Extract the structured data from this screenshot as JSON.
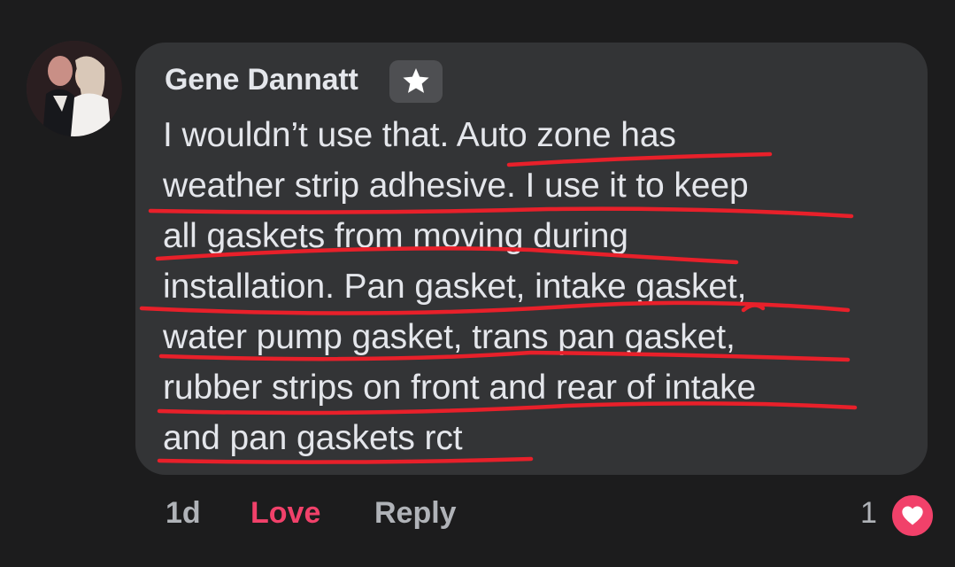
{
  "comment": {
    "author": "Gene Dannatt",
    "badge_icon": "star-icon",
    "lines": [
      "I wouldn’t use that. Auto zone has",
      "weather strip adhesive. I use it to keep",
      "all gaskets from moving during",
      "installation. Pan gasket, intake gasket,",
      "water pump gasket, trans pan gasket,",
      "rubber strips on front and rear of intake",
      "and pan gaskets rct"
    ],
    "underline_color": "#e8202a"
  },
  "actions": {
    "time": "1d",
    "love": "Love",
    "reply": "Reply",
    "love_color": "#f1416a"
  },
  "reactions": {
    "count": "1",
    "icon": "heart-icon"
  }
}
